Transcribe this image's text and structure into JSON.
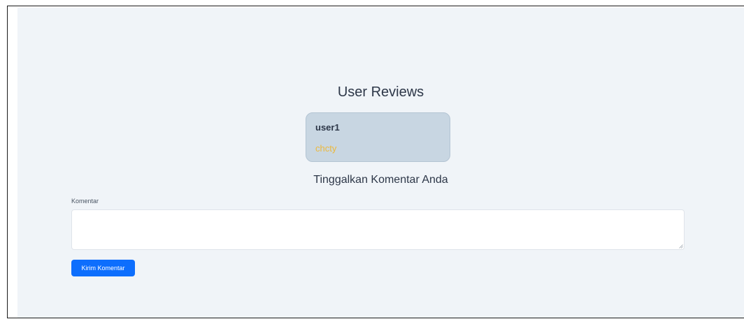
{
  "reviews": {
    "heading": "User Reviews",
    "items": [
      {
        "user": "user1",
        "text": "chcty"
      }
    ]
  },
  "form": {
    "heading": "Tinggalkan Komentar Anda",
    "comment_label": "Komentar",
    "comment_value": "",
    "submit_label": "Kirim Komentar"
  },
  "colors": {
    "page_background": "#f0f4f8",
    "card_background": "#c8d6e2",
    "review_text": "#ecb93c",
    "button": "#0d6efd"
  }
}
